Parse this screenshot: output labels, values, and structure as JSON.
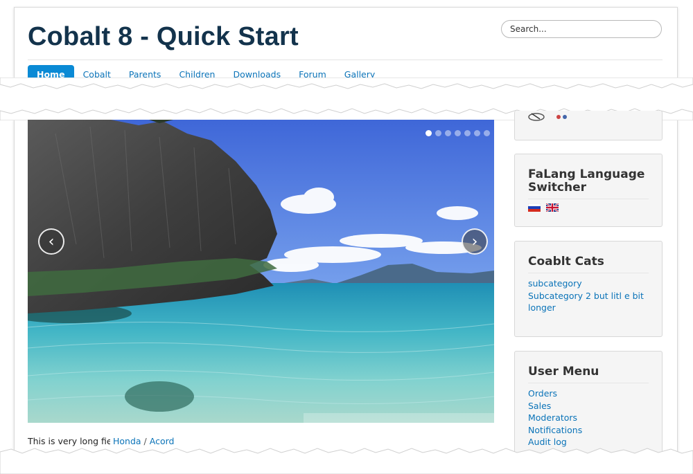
{
  "header": {
    "site_title": "Cobalt 8 - Quick Start",
    "search_placeholder": "Search..."
  },
  "nav": {
    "items": [
      "Home",
      "Cobalt",
      "Parents",
      "Children",
      "Downloads",
      "Forum",
      "Gallery"
    ],
    "active": "Home"
  },
  "slider": {
    "dot_count": 7,
    "active_dot": 1,
    "prev_symbol": "‹",
    "next_symbol": "›"
  },
  "content": {
    "caption_text": "This is very long field",
    "links": [
      "Honda",
      "Acord"
    ],
    "separator": "/"
  },
  "sidebar": {
    "language_switcher": {
      "title": "FaLang Language Switcher",
      "languages": [
        "Russian",
        "English"
      ]
    },
    "cats": {
      "title": "Coablt Cats",
      "items": [
        "subcategory",
        "Subcategory 2 but litl e bit longer"
      ]
    },
    "user_menu": {
      "title": "User Menu",
      "items": [
        "Orders",
        "Sales",
        "Moderators",
        "Notifications",
        "Audit log"
      ]
    }
  },
  "colors": {
    "title": "#13334c",
    "link": "#0a73b8",
    "nav_active_bg": "#0a8ad5",
    "panel_bg": "#f5f5f5"
  }
}
